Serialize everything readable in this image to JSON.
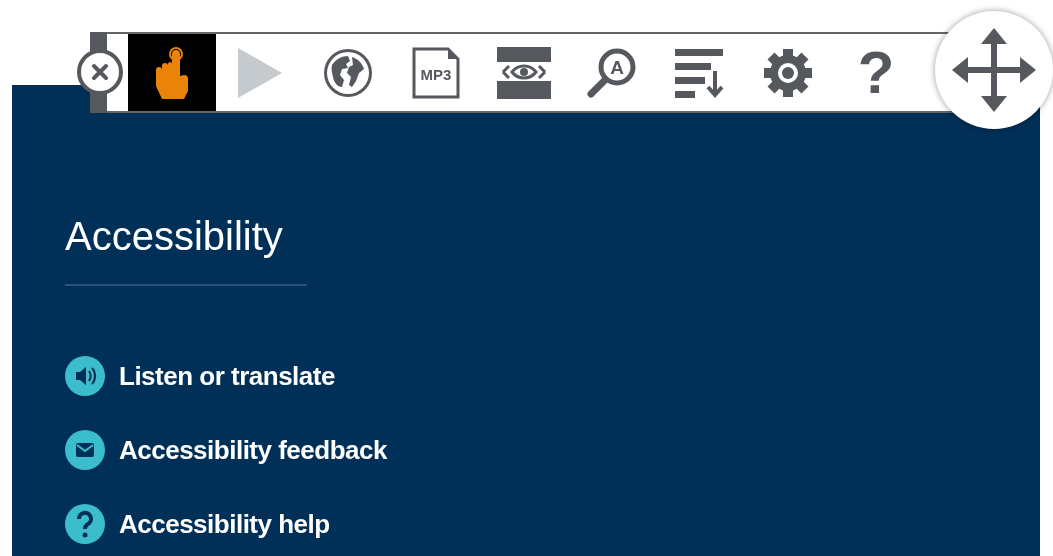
{
  "toolbar": {
    "tools": [
      {
        "kind": "pointer",
        "selected": true,
        "disabled": false
      },
      {
        "kind": "play",
        "selected": false,
        "disabled": true
      },
      {
        "kind": "translate",
        "selected": false,
        "disabled": false
      },
      {
        "kind": "mp3",
        "selected": false,
        "disabled": false,
        "label": "MP3"
      },
      {
        "kind": "mask",
        "selected": false,
        "disabled": false
      },
      {
        "kind": "magnifier",
        "selected": false,
        "disabled": false,
        "label": "A"
      },
      {
        "kind": "playlist",
        "selected": false,
        "disabled": false
      },
      {
        "kind": "settings",
        "selected": false,
        "disabled": false
      },
      {
        "kind": "help",
        "selected": false,
        "disabled": false,
        "label": "?"
      }
    ]
  },
  "panel": {
    "heading": "Accessibility",
    "links": [
      {
        "kind": "listen",
        "label": "Listen or translate"
      },
      {
        "kind": "feedback",
        "label": "Accessibility feedback"
      },
      {
        "kind": "help",
        "label": "Accessibility help"
      }
    ]
  }
}
